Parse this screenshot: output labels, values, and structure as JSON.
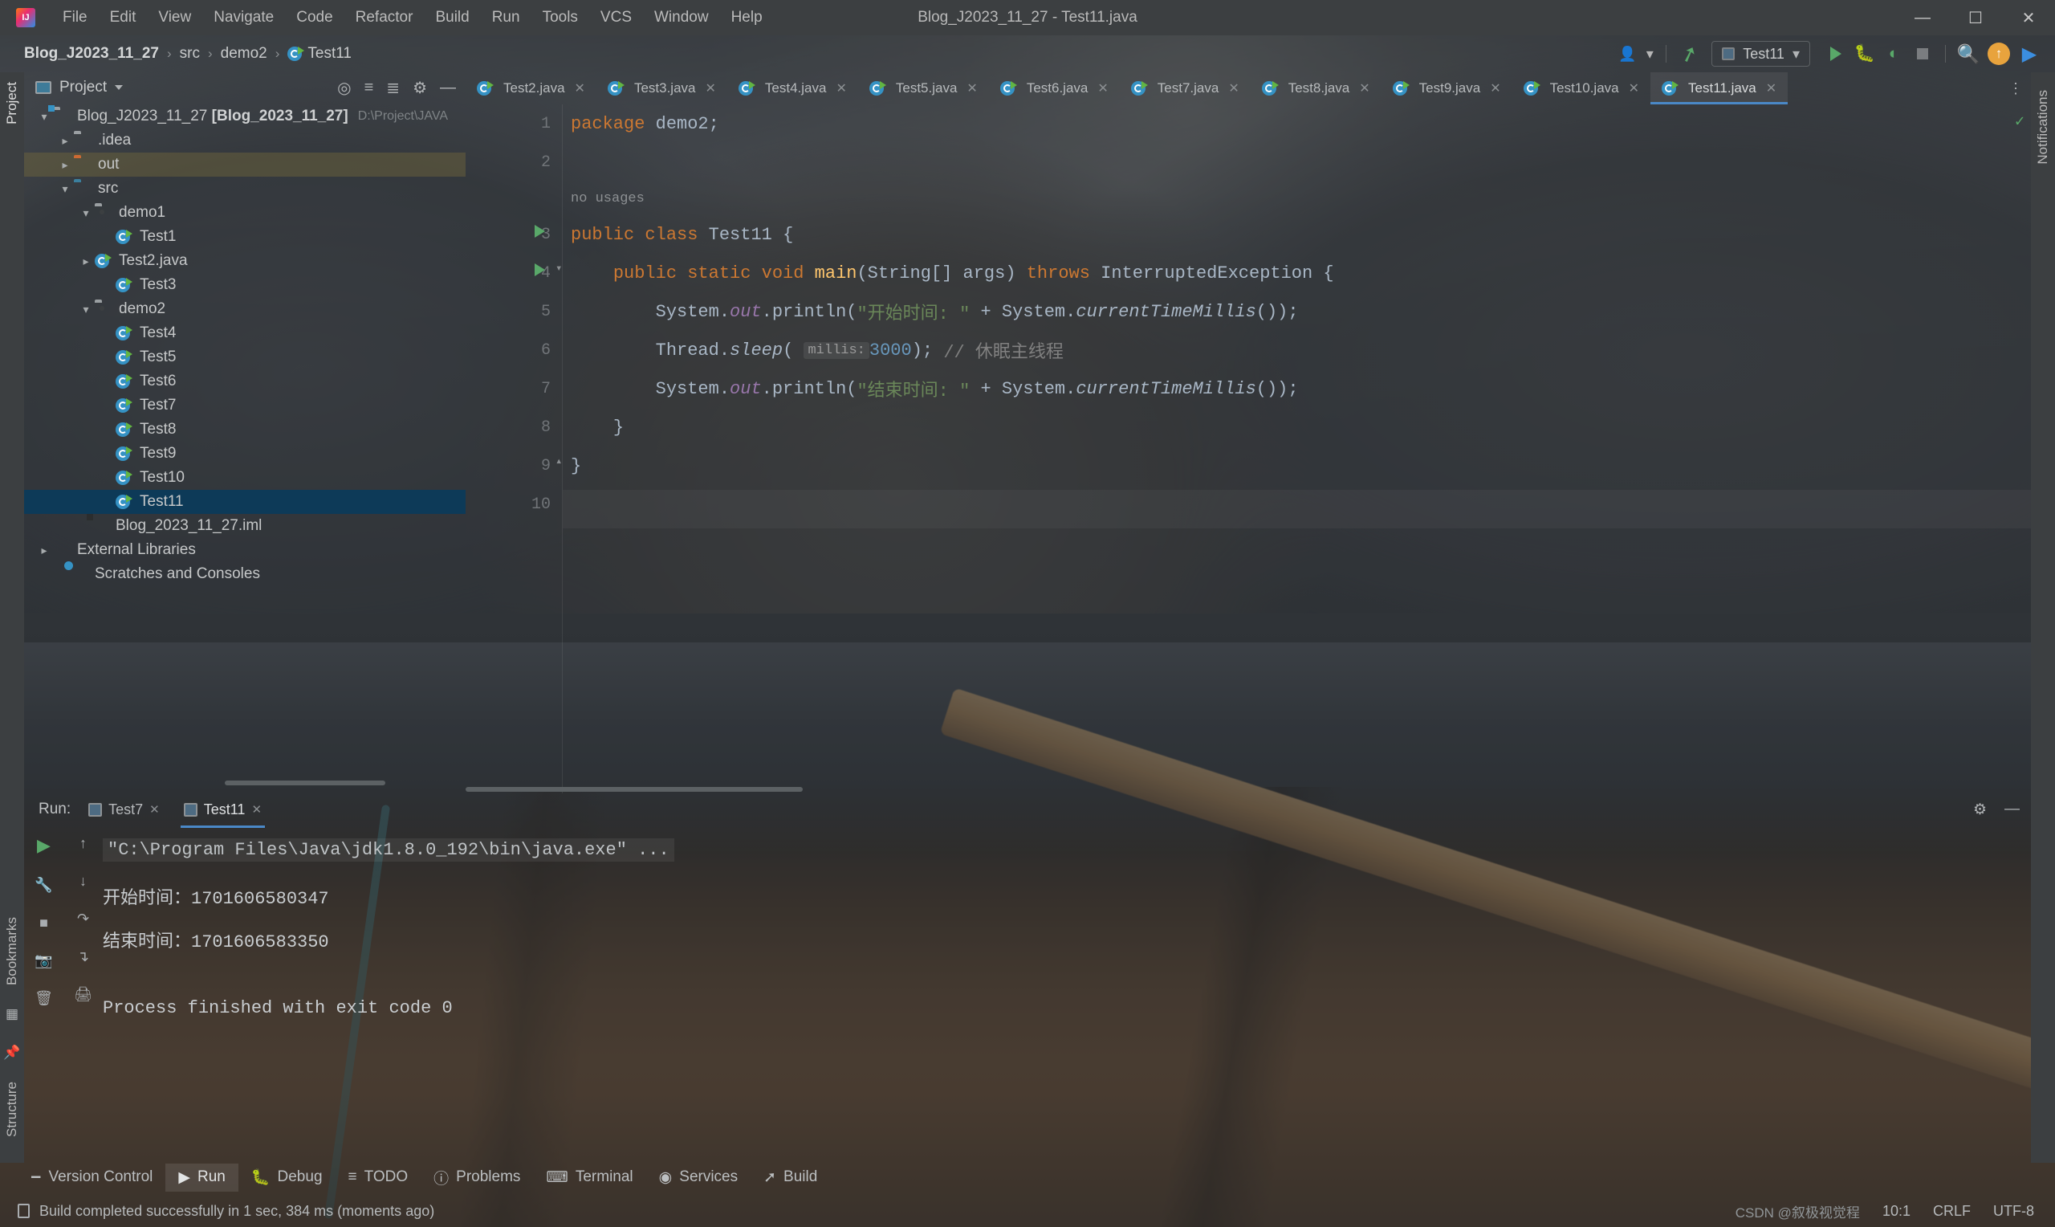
{
  "window": {
    "title": "Blog_J2023_11_27 - Test11.java",
    "logo_icon": "intellij-idea-logo",
    "minimize_icon": "minimize-icon",
    "maximize_icon": "maximize-icon",
    "close_icon": "close-icon"
  },
  "menubar": {
    "items": [
      "File",
      "Edit",
      "View",
      "Navigate",
      "Code",
      "Refactor",
      "Build",
      "Run",
      "Tools",
      "VCS",
      "Window",
      "Help"
    ]
  },
  "breadcrumb": {
    "items": [
      "Blog_J2023_11_27",
      "src",
      "demo2",
      "Test11"
    ],
    "separator": "›",
    "file_icon": "java-class-icon"
  },
  "toolbar": {
    "user_icon": "user-account-icon",
    "updates_icon": "build-hammer-icon",
    "run_config_name": "Test11",
    "run_config_icon": "run-config-icon",
    "dropdown_icon": "chevron-down-icon",
    "run_icon": "run-play-icon",
    "debug_icon": "debug-bug-icon",
    "run_coverage_icon": "run-with-coverage-icon",
    "stop_icon": "stop-square-icon",
    "search_icon": "search-everywhere-icon",
    "update_project_icon": "update-project-icon",
    "ide_icon": "ide-gradient-icon"
  },
  "left_strip": {
    "project_tab": "Project",
    "bookmarks_tab": "Bookmarks",
    "structure_tab": "Structure",
    "commit_icon": "commit-icon",
    "pin_icon": "pin-icon"
  },
  "right_strip": {
    "notifications_tab": "Notifications"
  },
  "project_panel": {
    "title": "Project",
    "title_icon": "project-view-icon",
    "dropdown_icon": "chevron-down-icon",
    "head_icons": [
      "locate-icon",
      "collapse-all-icon",
      "expand-icon",
      "settings-gear-icon",
      "hide-icon"
    ],
    "tree": [
      {
        "label": "Blog_J2023_11_27",
        "suffix": "[Blog_2023_11_27]",
        "path": "D:\\Project\\JAVA",
        "depth": 0,
        "arrow": "down",
        "icon": "module-folder-icon",
        "state": "normal"
      },
      {
        "label": ".idea",
        "depth": 1,
        "arrow": "right",
        "icon": "folder-grey-icon",
        "state": "normal"
      },
      {
        "label": "out",
        "depth": 1,
        "arrow": "right",
        "icon": "folder-orange-icon",
        "state": "highlighted"
      },
      {
        "label": "src",
        "depth": 1,
        "arrow": "down",
        "icon": "folder-blue-source-icon",
        "state": "normal"
      },
      {
        "label": "demo1",
        "depth": 2,
        "arrow": "down",
        "icon": "package-icon",
        "state": "normal"
      },
      {
        "label": "Test1",
        "depth": 3,
        "arrow": "none",
        "icon": "java-class-icon",
        "state": "normal"
      },
      {
        "label": "Test2.java",
        "depth": 3,
        "arrow": "right",
        "icon": "java-class-icon",
        "state": "normal"
      },
      {
        "label": "Test3",
        "depth": 3,
        "arrow": "none",
        "icon": "java-class-icon",
        "state": "normal"
      },
      {
        "label": "demo2",
        "depth": 2,
        "arrow": "down",
        "icon": "package-icon",
        "state": "normal"
      },
      {
        "label": "Test4",
        "depth": 3,
        "arrow": "none",
        "icon": "java-class-icon",
        "state": "normal"
      },
      {
        "label": "Test5",
        "depth": 3,
        "arrow": "none",
        "icon": "java-class-icon",
        "state": "normal"
      },
      {
        "label": "Test6",
        "depth": 3,
        "arrow": "none",
        "icon": "java-class-icon",
        "state": "normal"
      },
      {
        "label": "Test7",
        "depth": 3,
        "arrow": "none",
        "icon": "java-class-icon",
        "state": "normal"
      },
      {
        "label": "Test8",
        "depth": 3,
        "arrow": "none",
        "icon": "java-class-icon",
        "state": "normal"
      },
      {
        "label": "Test9",
        "depth": 3,
        "arrow": "none",
        "icon": "java-class-icon",
        "state": "normal"
      },
      {
        "label": "Test10",
        "depth": 3,
        "arrow": "none",
        "icon": "java-class-icon",
        "state": "normal"
      },
      {
        "label": "Test11",
        "depth": 3,
        "arrow": "none",
        "icon": "java-class-icon",
        "state": "selected"
      },
      {
        "label": "Blog_2023_11_27.iml",
        "depth": 1,
        "arrow": "none",
        "icon": "iml-file-icon",
        "state": "normal"
      },
      {
        "label": "External Libraries",
        "depth": 0,
        "arrow": "right",
        "icon": "libraries-icon",
        "state": "normal"
      },
      {
        "label": "Scratches and Consoles",
        "depth": 0,
        "arrow": "none",
        "icon": "scratches-icon",
        "state": "normal"
      }
    ]
  },
  "editor": {
    "tabs": [
      {
        "label": "Test2.java",
        "active": false
      },
      {
        "label": "Test3.java",
        "active": false
      },
      {
        "label": "Test4.java",
        "active": false
      },
      {
        "label": "Test5.java",
        "active": false
      },
      {
        "label": "Test6.java",
        "active": false
      },
      {
        "label": "Test7.java",
        "active": false
      },
      {
        "label": "Test8.java",
        "active": false
      },
      {
        "label": "Test9.java",
        "active": false
      },
      {
        "label": "Test10.java",
        "active": false
      },
      {
        "label": "Test11.java",
        "active": true
      }
    ],
    "tab_close_icon": "close-icon",
    "tab_overflow_icon": "more-options-icon",
    "inspection_ok_icon": "inspections-ok-check-icon",
    "line_numbers": [
      "1",
      "2",
      "3",
      "4",
      "5",
      "6",
      "7",
      "8",
      "9",
      "10"
    ],
    "usage_hint": "no usages",
    "code_lines": [
      "package demo2;",
      "",
      "public class Test11 {",
      "    public static void main(String[] args) throws InterruptedException {",
      "        System.out.println(\"开始时间: \" + System.currentTimeMillis());",
      "        Thread.sleep( millis: 3000); // 休眠主线程",
      "        System.out.println(\"结束时间: \" + System.currentTimeMillis());",
      "    }",
      "}"
    ],
    "tokens": {
      "package_kw": "package",
      "package_name": " demo2;",
      "public_kw": "public",
      "class_kw": "class",
      "class_name": "Test11",
      "brace_open": "{",
      "static_kw": "static",
      "void_kw": "void",
      "main_name": "main",
      "main_params": "(String[] args)",
      "throws_kw": "throws",
      "exception_name": "InterruptedException",
      "sysout_start": "System.",
      "out_field": "out",
      "println": ".println(",
      "str_start": "\"开始时间: \"",
      "str_end": "\"结束时间: \"",
      "plus": " + System.",
      "currentTimeMillis": "currentTimeMillis",
      "call_close": "());",
      "thread": "Thread.",
      "sleep": "sleep",
      "paren": "(",
      "param_hint": "millis:",
      "sleep_value": "3000",
      "sleep_close": ");",
      "comment": "// 休眠主线程",
      "close_brace_inner": "}",
      "close_brace_outer": "}"
    }
  },
  "run_window": {
    "label": "Run:",
    "tabs": [
      {
        "label": "Test7",
        "active": false
      },
      {
        "label": "Test11",
        "active": true
      }
    ],
    "tab_icon": "run-config-icon",
    "close_icon": "close-icon",
    "settings_icon": "settings-gear-icon",
    "hide_icon": "hide-window-icon",
    "side_icons": [
      "rerun-play-icon",
      "scroll-up-icon",
      "wrench-settings-icon",
      "scroll-down-icon",
      "soft-wrap-icon",
      "stop-square-icon",
      "scroll-to-end-icon",
      "camera-icon",
      "print-icon",
      "trash-icon"
    ],
    "console": {
      "command": "\"C:\\Program Files\\Java\\jdk1.8.0_192\\bin\\java.exe\" ...",
      "lines": [
        "开始时间：1701606580347",
        "结束时间：1701606583350"
      ],
      "exit_line": "Process finished with exit code 0"
    }
  },
  "bottom_bar": {
    "items": [
      {
        "label": "Version Control",
        "icon": "branch-icon",
        "active": false
      },
      {
        "label": "Run",
        "icon": "run-play-icon",
        "active": true
      },
      {
        "label": "Debug",
        "icon": "debug-bug-icon",
        "active": false
      },
      {
        "label": "TODO",
        "icon": "todo-list-icon",
        "active": false
      },
      {
        "label": "Problems",
        "icon": "problems-icon",
        "active": false
      },
      {
        "label": "Terminal",
        "icon": "terminal-icon",
        "active": false
      },
      {
        "label": "Services",
        "icon": "services-icon",
        "active": false
      },
      {
        "label": "Build",
        "icon": "build-hammer-icon",
        "active": false
      }
    ]
  },
  "status_bar": {
    "message_icon": "event-log-icon",
    "message": "Build completed successfully in 1 sec, 384 ms (moments ago)",
    "caret_position": "10:1",
    "line_separator": "CRLF",
    "encoding": "UTF-8",
    "watermark": "CSDN @叙极视觉程"
  },
  "colors": {
    "accent_blue": "#4a88c7",
    "selection_blue": "#0d3a58",
    "green_run": "#59a869",
    "orange_keyword": "#cc7832",
    "string_green": "#6a8759",
    "number_blue": "#6897bb",
    "field_purple": "#9876aa",
    "method_yellow": "#ffc66d",
    "panel_bg": "#3c3f41"
  }
}
